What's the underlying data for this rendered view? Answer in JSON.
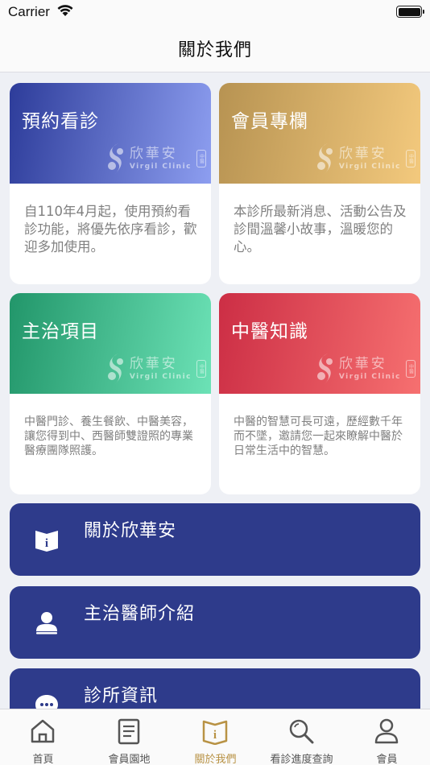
{
  "status_bar": {
    "carrier": "Carrier"
  },
  "nav": {
    "title": "關於我們"
  },
  "logo": {
    "cn": "欣華安",
    "en": "Virgil Clinic",
    "seal": "中醫"
  },
  "cards": [
    {
      "title": "預約看診",
      "desc": "自110年4月起，使用預約看診功能，將優先依序看診，歡迎多加使用。",
      "gradient_from": "#2d3c9a",
      "gradient_to": "#8d9ef0"
    },
    {
      "title": "會員專欄",
      "desc": "本診所最新消息、活動公告及診間溫馨小故事，溫暖您的心。",
      "gradient_from": "#b79352",
      "gradient_to": "#f3c97d"
    },
    {
      "title": "主治項目",
      "desc": "中醫門診、養生餐飲、中醫美容，讓您得到中、西醫師雙證照的專業醫療團隊照護。",
      "gradient_from": "#22966a",
      "gradient_to": "#6ce2b6"
    },
    {
      "title": "中醫知識",
      "desc": "中醫的智慧可長可遠，歷經數千年而不墜，邀請您一起來瞭解中醫於日常生活中的智慧。",
      "gradient_from": "#cc2e45",
      "gradient_to": "#f67070"
    }
  ],
  "links": [
    {
      "label": "關於欣華安",
      "icon": "info-book-icon"
    },
    {
      "label": "主治醫師介紹",
      "icon": "doctor-icon"
    },
    {
      "label": "診所資訊",
      "icon": "chat-bubble-icon"
    }
  ],
  "tabs": [
    {
      "label": "首頁",
      "icon": "home-icon"
    },
    {
      "label": "會員園地",
      "icon": "document-icon"
    },
    {
      "label": "關於我們",
      "icon": "info-book-icon",
      "active": true
    },
    {
      "label": "看診進度查詢",
      "icon": "search-icon"
    },
    {
      "label": "會員",
      "icon": "person-icon"
    }
  ],
  "colors": {
    "primary": "#2e3b8b",
    "active_tab": "#b89244",
    "inactive_tab": "#555555",
    "background": "#eef0f5"
  }
}
